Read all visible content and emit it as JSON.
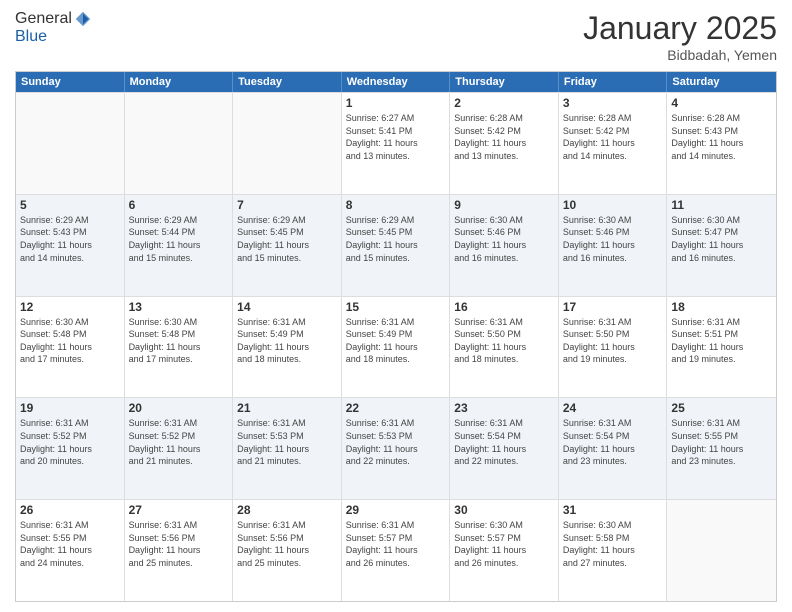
{
  "header": {
    "logo_line1": "General",
    "logo_line2": "Blue",
    "month": "January 2025",
    "location": "Bidbadah, Yemen"
  },
  "weekdays": [
    "Sunday",
    "Monday",
    "Tuesday",
    "Wednesday",
    "Thursday",
    "Friday",
    "Saturday"
  ],
  "rows": [
    [
      {
        "day": "",
        "lines": [],
        "empty": true
      },
      {
        "day": "",
        "lines": [],
        "empty": true
      },
      {
        "day": "",
        "lines": [],
        "empty": true
      },
      {
        "day": "1",
        "lines": [
          "Sunrise: 6:27 AM",
          "Sunset: 5:41 PM",
          "Daylight: 11 hours",
          "and 13 minutes."
        ]
      },
      {
        "day": "2",
        "lines": [
          "Sunrise: 6:28 AM",
          "Sunset: 5:42 PM",
          "Daylight: 11 hours",
          "and 13 minutes."
        ]
      },
      {
        "day": "3",
        "lines": [
          "Sunrise: 6:28 AM",
          "Sunset: 5:42 PM",
          "Daylight: 11 hours",
          "and 14 minutes."
        ]
      },
      {
        "day": "4",
        "lines": [
          "Sunrise: 6:28 AM",
          "Sunset: 5:43 PM",
          "Daylight: 11 hours",
          "and 14 minutes."
        ]
      }
    ],
    [
      {
        "day": "5",
        "lines": [
          "Sunrise: 6:29 AM",
          "Sunset: 5:43 PM",
          "Daylight: 11 hours",
          "and 14 minutes."
        ]
      },
      {
        "day": "6",
        "lines": [
          "Sunrise: 6:29 AM",
          "Sunset: 5:44 PM",
          "Daylight: 11 hours",
          "and 15 minutes."
        ]
      },
      {
        "day": "7",
        "lines": [
          "Sunrise: 6:29 AM",
          "Sunset: 5:45 PM",
          "Daylight: 11 hours",
          "and 15 minutes."
        ]
      },
      {
        "day": "8",
        "lines": [
          "Sunrise: 6:29 AM",
          "Sunset: 5:45 PM",
          "Daylight: 11 hours",
          "and 15 minutes."
        ]
      },
      {
        "day": "9",
        "lines": [
          "Sunrise: 6:30 AM",
          "Sunset: 5:46 PM",
          "Daylight: 11 hours",
          "and 16 minutes."
        ]
      },
      {
        "day": "10",
        "lines": [
          "Sunrise: 6:30 AM",
          "Sunset: 5:46 PM",
          "Daylight: 11 hours",
          "and 16 minutes."
        ]
      },
      {
        "day": "11",
        "lines": [
          "Sunrise: 6:30 AM",
          "Sunset: 5:47 PM",
          "Daylight: 11 hours",
          "and 16 minutes."
        ]
      }
    ],
    [
      {
        "day": "12",
        "lines": [
          "Sunrise: 6:30 AM",
          "Sunset: 5:48 PM",
          "Daylight: 11 hours",
          "and 17 minutes."
        ]
      },
      {
        "day": "13",
        "lines": [
          "Sunrise: 6:30 AM",
          "Sunset: 5:48 PM",
          "Daylight: 11 hours",
          "and 17 minutes."
        ]
      },
      {
        "day": "14",
        "lines": [
          "Sunrise: 6:31 AM",
          "Sunset: 5:49 PM",
          "Daylight: 11 hours",
          "and 18 minutes."
        ]
      },
      {
        "day": "15",
        "lines": [
          "Sunrise: 6:31 AM",
          "Sunset: 5:49 PM",
          "Daylight: 11 hours",
          "and 18 minutes."
        ]
      },
      {
        "day": "16",
        "lines": [
          "Sunrise: 6:31 AM",
          "Sunset: 5:50 PM",
          "Daylight: 11 hours",
          "and 18 minutes."
        ]
      },
      {
        "day": "17",
        "lines": [
          "Sunrise: 6:31 AM",
          "Sunset: 5:50 PM",
          "Daylight: 11 hours",
          "and 19 minutes."
        ]
      },
      {
        "day": "18",
        "lines": [
          "Sunrise: 6:31 AM",
          "Sunset: 5:51 PM",
          "Daylight: 11 hours",
          "and 19 minutes."
        ]
      }
    ],
    [
      {
        "day": "19",
        "lines": [
          "Sunrise: 6:31 AM",
          "Sunset: 5:52 PM",
          "Daylight: 11 hours",
          "and 20 minutes."
        ]
      },
      {
        "day": "20",
        "lines": [
          "Sunrise: 6:31 AM",
          "Sunset: 5:52 PM",
          "Daylight: 11 hours",
          "and 21 minutes."
        ]
      },
      {
        "day": "21",
        "lines": [
          "Sunrise: 6:31 AM",
          "Sunset: 5:53 PM",
          "Daylight: 11 hours",
          "and 21 minutes."
        ]
      },
      {
        "day": "22",
        "lines": [
          "Sunrise: 6:31 AM",
          "Sunset: 5:53 PM",
          "Daylight: 11 hours",
          "and 22 minutes."
        ]
      },
      {
        "day": "23",
        "lines": [
          "Sunrise: 6:31 AM",
          "Sunset: 5:54 PM",
          "Daylight: 11 hours",
          "and 22 minutes."
        ]
      },
      {
        "day": "24",
        "lines": [
          "Sunrise: 6:31 AM",
          "Sunset: 5:54 PM",
          "Daylight: 11 hours",
          "and 23 minutes."
        ]
      },
      {
        "day": "25",
        "lines": [
          "Sunrise: 6:31 AM",
          "Sunset: 5:55 PM",
          "Daylight: 11 hours",
          "and 23 minutes."
        ]
      }
    ],
    [
      {
        "day": "26",
        "lines": [
          "Sunrise: 6:31 AM",
          "Sunset: 5:55 PM",
          "Daylight: 11 hours",
          "and 24 minutes."
        ]
      },
      {
        "day": "27",
        "lines": [
          "Sunrise: 6:31 AM",
          "Sunset: 5:56 PM",
          "Daylight: 11 hours",
          "and 25 minutes."
        ]
      },
      {
        "day": "28",
        "lines": [
          "Sunrise: 6:31 AM",
          "Sunset: 5:56 PM",
          "Daylight: 11 hours",
          "and 25 minutes."
        ]
      },
      {
        "day": "29",
        "lines": [
          "Sunrise: 6:31 AM",
          "Sunset: 5:57 PM",
          "Daylight: 11 hours",
          "and 26 minutes."
        ]
      },
      {
        "day": "30",
        "lines": [
          "Sunrise: 6:30 AM",
          "Sunset: 5:57 PM",
          "Daylight: 11 hours",
          "and 26 minutes."
        ]
      },
      {
        "day": "31",
        "lines": [
          "Sunrise: 6:30 AM",
          "Sunset: 5:58 PM",
          "Daylight: 11 hours",
          "and 27 minutes."
        ]
      },
      {
        "day": "",
        "lines": [],
        "empty": true
      }
    ]
  ]
}
